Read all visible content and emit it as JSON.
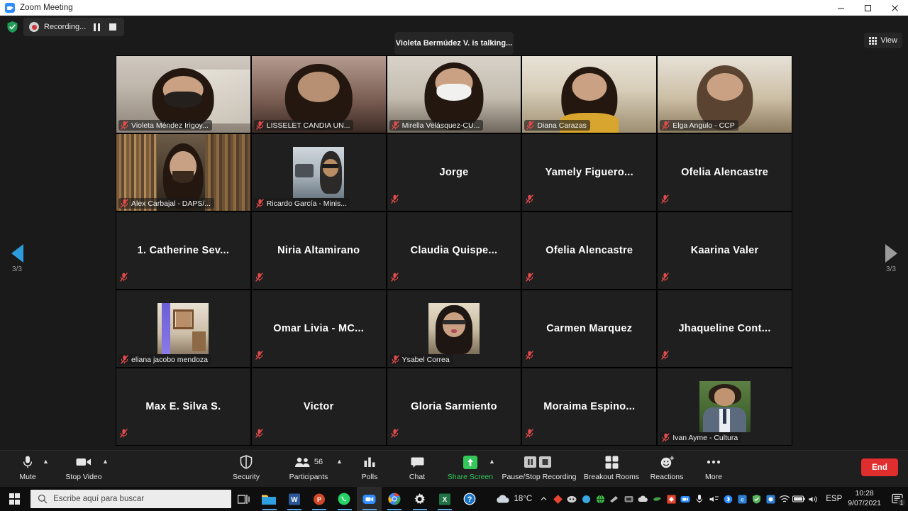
{
  "window": {
    "title": "Zoom Meeting",
    "app_icon": "zoom-icon",
    "minimize_label": "Minimize",
    "maximize_label": "Maximize",
    "close_label": "Close"
  },
  "topbar": {
    "encryption_icon": "shield-check-icon",
    "recording": {
      "label": "Recording...",
      "record_icon": "record-dot-icon",
      "pause_label": "Pause Recording",
      "stop_label": "Stop Recording"
    },
    "talking_banner": "Violeta Bermúdez V. is talking...",
    "view": {
      "label": "View",
      "icon": "grid-view-icon"
    }
  },
  "navigation": {
    "prev_label": "Previous page",
    "next_label": "Next page",
    "page_indicator_left": "3/3",
    "page_indicator_right": "3/3"
  },
  "gallery": {
    "participants": [
      {
        "name": "Violeta Méndez Irigoy...",
        "video": true,
        "position": "label",
        "muted": true,
        "art": "v1"
      },
      {
        "name": "LISSELET CANDIA UN...",
        "video": true,
        "position": "label",
        "muted": true,
        "art": "v2"
      },
      {
        "name": "Mirella Velásquez-CU...",
        "video": true,
        "position": "label",
        "muted": true,
        "art": "v3"
      },
      {
        "name": "Diana Carazas",
        "video": true,
        "position": "label",
        "muted": true,
        "art": "v4"
      },
      {
        "name": "Elga Angulo - CCP",
        "video": true,
        "position": "label",
        "muted": true,
        "art": "v5"
      },
      {
        "name": "Alex Carbajal - DAPS/...",
        "video": true,
        "position": "label",
        "muted": true,
        "art": "v6"
      },
      {
        "name": "Ricardo García - Minis...",
        "video": true,
        "position": "label",
        "muted": true,
        "art": "sub1"
      },
      {
        "name": "Jorge",
        "video": false,
        "position": "center",
        "muted": true
      },
      {
        "name": "Yamely  Figuero...",
        "video": false,
        "position": "center",
        "muted": true
      },
      {
        "name": "Ofelia Alencastre",
        "video": false,
        "position": "center",
        "muted": true
      },
      {
        "name": "1.  Catherine  Sev...",
        "video": false,
        "position": "center",
        "muted": true
      },
      {
        "name": "Niria Altamirano",
        "video": false,
        "position": "center",
        "muted": true
      },
      {
        "name": "Claudia  Quispe...",
        "video": false,
        "position": "center",
        "muted": true
      },
      {
        "name": "Ofelia Alencastre",
        "video": false,
        "position": "center",
        "muted": true
      },
      {
        "name": "Kaarina Valer",
        "video": false,
        "position": "center",
        "muted": true
      },
      {
        "name": "eliana jacobo mendoza",
        "video": true,
        "position": "label",
        "muted": true,
        "art": "sub2"
      },
      {
        "name": "Omar Livia - MC...",
        "video": false,
        "position": "center",
        "muted": true
      },
      {
        "name": "Ysabel Correa",
        "video": true,
        "position": "label",
        "muted": true,
        "art": "sub3"
      },
      {
        "name": "Carmen Marquez",
        "video": false,
        "position": "center",
        "muted": true
      },
      {
        "name": "Jhaqueline  Cont...",
        "video": false,
        "position": "center",
        "muted": true
      },
      {
        "name": "Max E. Silva S.",
        "video": false,
        "position": "center",
        "muted": true
      },
      {
        "name": "Victor",
        "video": false,
        "position": "center",
        "muted": true
      },
      {
        "name": "Gloria Sarmiento",
        "video": false,
        "position": "center",
        "muted": true
      },
      {
        "name": "Moraima  Espino...",
        "video": false,
        "position": "center",
        "muted": true
      },
      {
        "name": "Ivan Ayme - Cultura",
        "video": true,
        "position": "label",
        "muted": true,
        "art": "sub4"
      }
    ]
  },
  "toolbar": {
    "mute": {
      "label": "Mute",
      "icon": "microphone-icon",
      "has_caret": true
    },
    "video": {
      "label": "Stop Video",
      "icon": "camera-icon",
      "has_caret": true
    },
    "security": {
      "label": "Security",
      "icon": "shield-icon"
    },
    "participants": {
      "label": "Participants",
      "icon": "people-icon",
      "count": "56",
      "has_caret": true
    },
    "polls": {
      "label": "Polls",
      "icon": "bar-chart-icon"
    },
    "chat": {
      "label": "Chat",
      "icon": "chat-bubble-icon"
    },
    "share_screen": {
      "label": "Share Screen",
      "icon": "share-up-arrow-icon",
      "has_caret": true,
      "color": "#34c759"
    },
    "recording_controls": {
      "label": "Pause/Stop Recording",
      "icon": "pause-stop-icon"
    },
    "breakout": {
      "label": "Breakout Rooms",
      "icon": "squares-icon"
    },
    "reactions": {
      "label": "Reactions",
      "icon": "smiley-plus-icon"
    },
    "more": {
      "label": "More",
      "icon": "ellipsis-icon"
    },
    "end": {
      "label": "End"
    }
  },
  "taskbar": {
    "start_label": "Start",
    "search_placeholder": "Escribe aquí para buscar",
    "search_icon": "search-icon",
    "task_view_label": "Task View",
    "pinned": [
      {
        "name": "file-explorer-icon",
        "label": "File Explorer"
      },
      {
        "name": "word-icon",
        "label": "Word"
      },
      {
        "name": "powerpoint-icon",
        "label": "PowerPoint"
      },
      {
        "name": "whatsapp-icon",
        "label": "WhatsApp"
      },
      {
        "name": "zoom-icon",
        "label": "Zoom"
      },
      {
        "name": "chrome-icon",
        "label": "Google Chrome"
      },
      {
        "name": "settings-icon",
        "label": "Settings"
      },
      {
        "name": "excel-icon",
        "label": "Excel"
      },
      {
        "name": "help-icon",
        "label": "Help"
      }
    ],
    "weather": {
      "temperature": "18°C",
      "icon": "cloud-icon"
    },
    "language": "ESP",
    "clock": {
      "time": "10:28",
      "date": "9/07/2021"
    },
    "notification_count": "1"
  }
}
